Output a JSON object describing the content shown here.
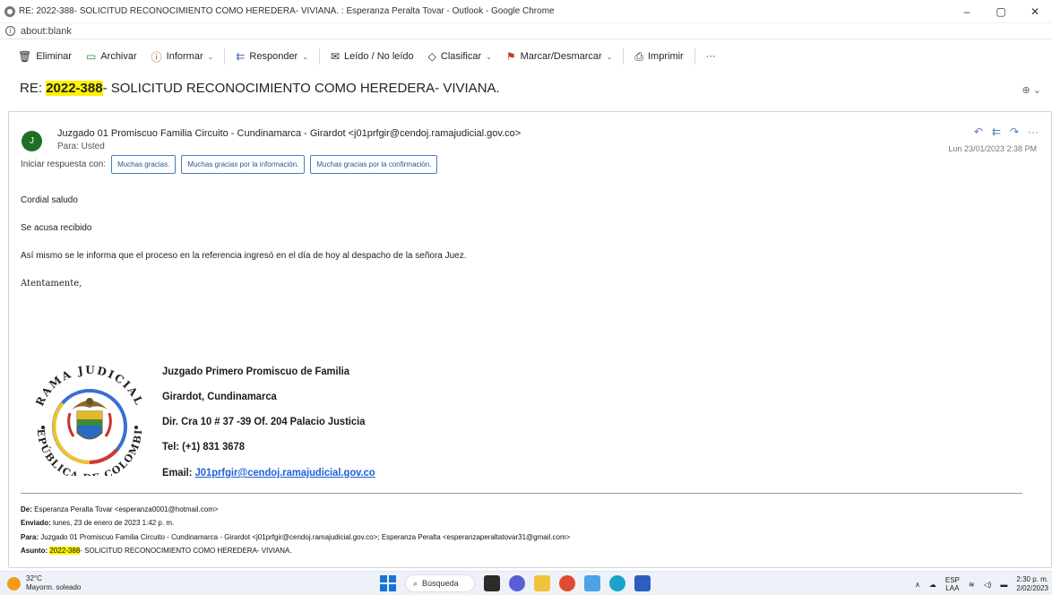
{
  "browser": {
    "window_title": "RE: 2022-388- SOLICITUD RECONOCIMIENTO COMO HEREDERA- VIVIANA. : Esperanza Peralta Tovar - Outlook - Google Chrome",
    "address": "about:blank",
    "minimize": "–",
    "maximize": "▢",
    "close": "✕"
  },
  "toolbar": {
    "delete": "Eliminar",
    "archive": "Archivar",
    "report": "Informar",
    "reply": "Responder",
    "read_unread": "Leído / No leído",
    "categorize": "Clasificar",
    "flag": "Marcar/Desmarcar",
    "print": "Imprimir",
    "more": "···"
  },
  "subject": {
    "prefix": "RE: ",
    "ref": "2022-388",
    "rest": "- SOLICITUD RECONOCIMIENTO COMO HEREDERA- VIVIANA."
  },
  "message": {
    "avatar_initial": "J",
    "sender": "Juzgado 01 Promiscuo Familia Circuito - Cundinamarca - Girardot <j01prfgir@cendoj.ramajudicial.gov.co>",
    "to": "Para: Usted",
    "date": "Lun 23/01/2023 2:38 PM",
    "quick_reply_label": "Iniciar respuesta con:",
    "quick_replies": [
      "Muchas gracias.",
      "Muchas gracias por la información.",
      "Muchas gracias por la confirmación."
    ],
    "body": [
      "Cordial saludo",
      "Se acusa recibido",
      "Así mismo se le informa que el proceso en la referencia ingresó en el día de hoy al despacho de la señora Juez.",
      "Atentamente,"
    ]
  },
  "signature": {
    "seal_top": "RAMA JUDICIAL",
    "seal_bottom": "REPÚBLICA DE COLOMBIA",
    "line1": "Juzgado Primero Promiscuo de Familia",
    "line2": "Girardot, Cundinamarca",
    "line3": "Dir. Cra 10 # 37 -39 Of. 204 Palacio Justicia",
    "line4": "Tel: (+1) 831 3678",
    "email_label": "Email: ",
    "email": "J01prfgir@cendoj.ramajudicial.gov.co"
  },
  "quoted": {
    "from_label": "De:",
    "from": " Esperanza Peralta Tovar <esperanza0001@hotmail.com>",
    "sent_label": "Enviado:",
    "sent": " lunes, 23 de enero de 2023 1:42 p. m.",
    "to_label": "Para:",
    "to": " Juzgado 01 Promiscuo Familia Circuito - Cundinamarca - Girardot <j01prfgir@cendoj.ramajudicial.gov.co>; Esperanza Peralta <esperanzaperaltatovar31@gmail.com>",
    "subject_label": "Asunto:",
    "subject_ref": "2022-388",
    "subject_rest": "- SOLICITUD RECONOCIMIENTO COMO HEREDERA- VIVIANA."
  },
  "taskbar": {
    "temp": "32°C",
    "weather": "Mayorm. soleado",
    "search": "Búsqueda",
    "lang_top": "ESP",
    "lang_bottom": "LAA",
    "time": "2:30 p. m.",
    "date": "2/02/2023"
  },
  "colors": {
    "highlight": "#fff200",
    "avatar": "#1f6f28",
    "link": "#1f5fd6"
  }
}
